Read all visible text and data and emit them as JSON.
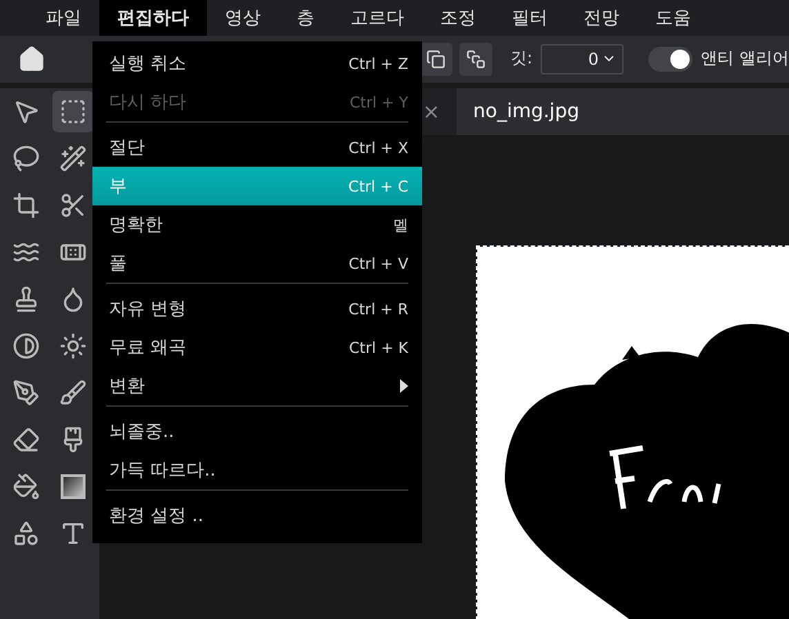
{
  "menubar": [
    {
      "label": "파일",
      "selected": false
    },
    {
      "label": "편집하다",
      "selected": true
    },
    {
      "label": "영상",
      "selected": false
    },
    {
      "label": "층",
      "selected": false
    },
    {
      "label": "고르다",
      "selected": false
    },
    {
      "label": "조정",
      "selected": false
    },
    {
      "label": "필터",
      "selected": false
    },
    {
      "label": "전망",
      "selected": false
    },
    {
      "label": "도움",
      "selected": false
    }
  ],
  "toolbar": {
    "feather_label": "깃:",
    "feather_value": "0",
    "antialias": {
      "label": "앤티 앨리어",
      "on": true
    }
  },
  "menu": [
    {
      "label": "실행 취소",
      "shortcut": "Ctrl + Z",
      "disabled": false,
      "selected": false,
      "separator_before": false,
      "submenu": false
    },
    {
      "label": "다시 하다",
      "shortcut": "Ctrl + Y",
      "disabled": true,
      "selected": false,
      "separator_before": false,
      "submenu": false
    },
    {
      "label": "절단",
      "shortcut": "Ctrl + X",
      "disabled": false,
      "selected": false,
      "separator_before": true,
      "submenu": false
    },
    {
      "label": "부",
      "shortcut": "Ctrl + C",
      "disabled": false,
      "selected": true,
      "separator_before": false,
      "submenu": false
    },
    {
      "label": "명확한",
      "shortcut": "멜",
      "disabled": false,
      "selected": false,
      "separator_before": false,
      "submenu": false
    },
    {
      "label": "풀",
      "shortcut": "Ctrl + V",
      "disabled": false,
      "selected": false,
      "separator_before": false,
      "submenu": false
    },
    {
      "label": "자유 변형",
      "shortcut": "Ctrl + R",
      "disabled": false,
      "selected": false,
      "separator_before": true,
      "submenu": false
    },
    {
      "label": "무료 왜곡",
      "shortcut": "Ctrl + K",
      "disabled": false,
      "selected": false,
      "separator_before": false,
      "submenu": false
    },
    {
      "label": "변환",
      "disabled": false,
      "selected": false,
      "separator_before": false,
      "submenu": true
    },
    {
      "label": "뇌졸중..",
      "disabled": false,
      "selected": false,
      "separator_before": true,
      "submenu": false
    },
    {
      "label": "가득 따르다..",
      "disabled": false,
      "selected": false,
      "separator_before": false,
      "submenu": false
    },
    {
      "label": "환경 설정 ..",
      "disabled": false,
      "selected": false,
      "separator_before": true,
      "submenu": false
    }
  ],
  "tabs": [
    {
      "close": "×",
      "selected": false
    },
    {
      "label": "no_img.jpg",
      "selected": true
    }
  ],
  "tools": [
    {
      "kind": "move",
      "selected": false
    },
    {
      "kind": "marquee",
      "selected": true
    },
    {
      "kind": "lasso",
      "selected": false
    },
    {
      "kind": "wand",
      "selected": false
    },
    {
      "kind": "crop",
      "selected": false
    },
    {
      "kind": "scissors",
      "selected": false
    },
    {
      "kind": "liquify",
      "selected": false
    },
    {
      "kind": "heal",
      "selected": false
    },
    {
      "kind": "stamp",
      "selected": false
    },
    {
      "kind": "blur",
      "selected": false
    },
    {
      "kind": "dodge",
      "selected": false
    },
    {
      "kind": "sponge",
      "selected": false
    },
    {
      "kind": "pencil",
      "selected": false
    },
    {
      "kind": "brush",
      "selected": false
    },
    {
      "kind": "eraser",
      "selected": false
    },
    {
      "kind": "replace",
      "selected": false
    },
    {
      "kind": "fill",
      "selected": false
    },
    {
      "kind": "gradient",
      "selected": false
    },
    {
      "kind": "shape",
      "selected": false
    },
    {
      "kind": "text",
      "selected": false
    }
  ]
}
